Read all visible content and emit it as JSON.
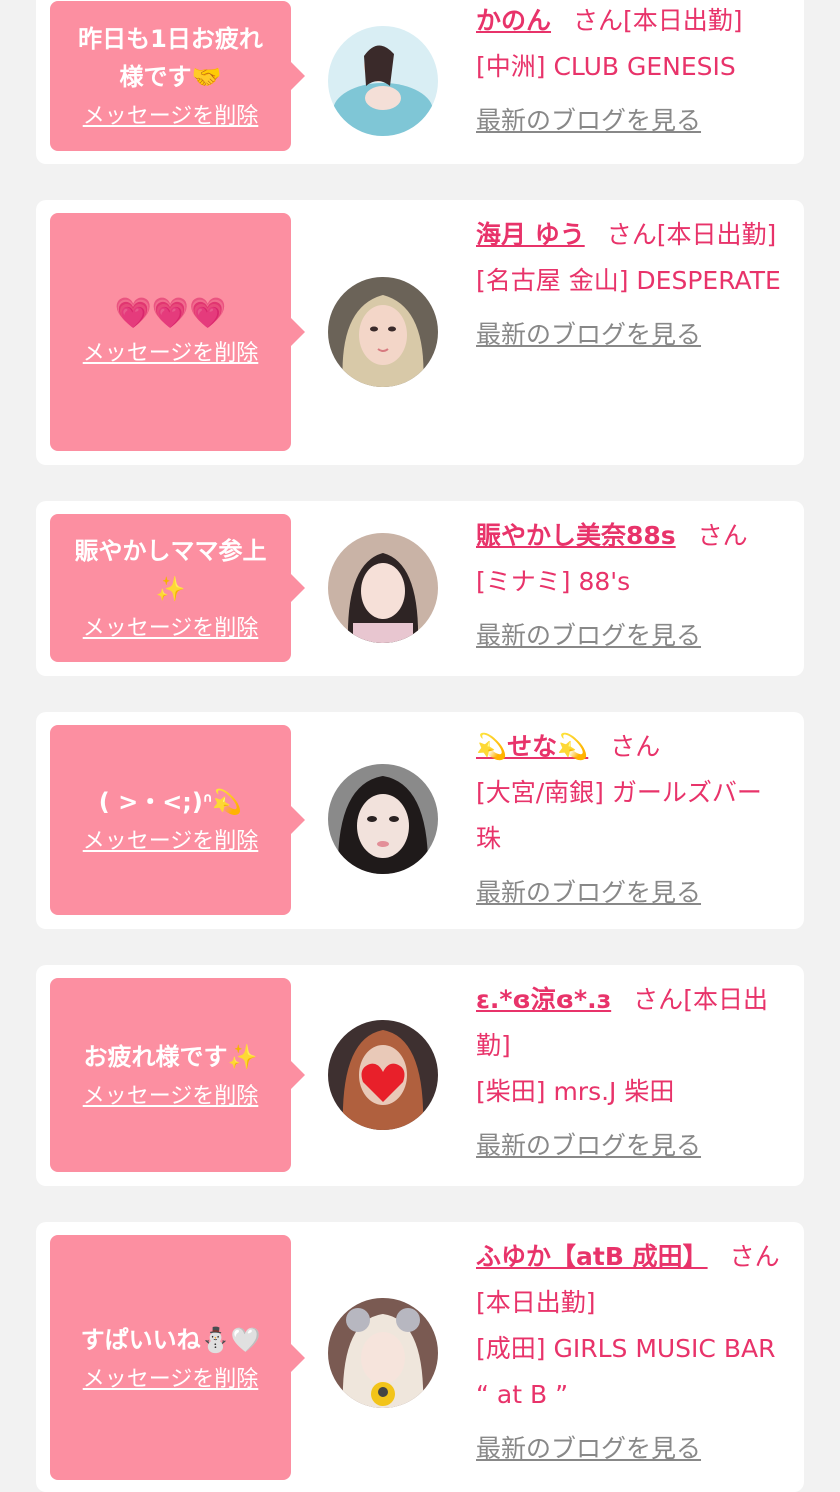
{
  "colors": {
    "background": "#f2f2f2",
    "bubble": "#fc8fa1",
    "accent_text": "#e8336a",
    "link_gray": "#888888"
  },
  "san_label": "さん",
  "delete_label": "メッセージを削除",
  "blog_label": "最新のブログを見る",
  "entries": [
    {
      "message": "昨日も1日お疲れ\n様です🤝",
      "name": "かのん",
      "status": "[本日出勤]",
      "location": "[中洲] CLUB GENESIS",
      "avatar_icon": "avatar-kanon"
    },
    {
      "message": "💗💗💗",
      "name": "海月 ゆう",
      "status": "[本日出勤]",
      "location": "[名古屋 金山] DESPERATE",
      "avatar_icon": "avatar-yuu"
    },
    {
      "message": "賑やかしママ参上\n✨",
      "name": "賑やかし美奈88s",
      "status": "",
      "location": "[ミナミ] 88's",
      "avatar_icon": "avatar-mina"
    },
    {
      "message": "( >・<;)ᐢ💫",
      "name": "💫せな💫",
      "status": "",
      "location": "[大宮/南銀] ガールズバー 珠",
      "avatar_icon": "avatar-sena"
    },
    {
      "message": "お疲れ様です✨",
      "name": "ε.*ɞ涼ɞ*.з",
      "status": "[本日出勤]",
      "location": "[柴田] mrs.J 柴田",
      "avatar_icon": "avatar-ryo"
    },
    {
      "message": "すぱいいね⛄🤍",
      "name": "ふゆか【atB 成田】",
      "status": "[本日出勤]",
      "location": "[成田] GIRLS MUSIC BAR “ at B ”",
      "avatar_icon": "avatar-fuyuka"
    }
  ]
}
